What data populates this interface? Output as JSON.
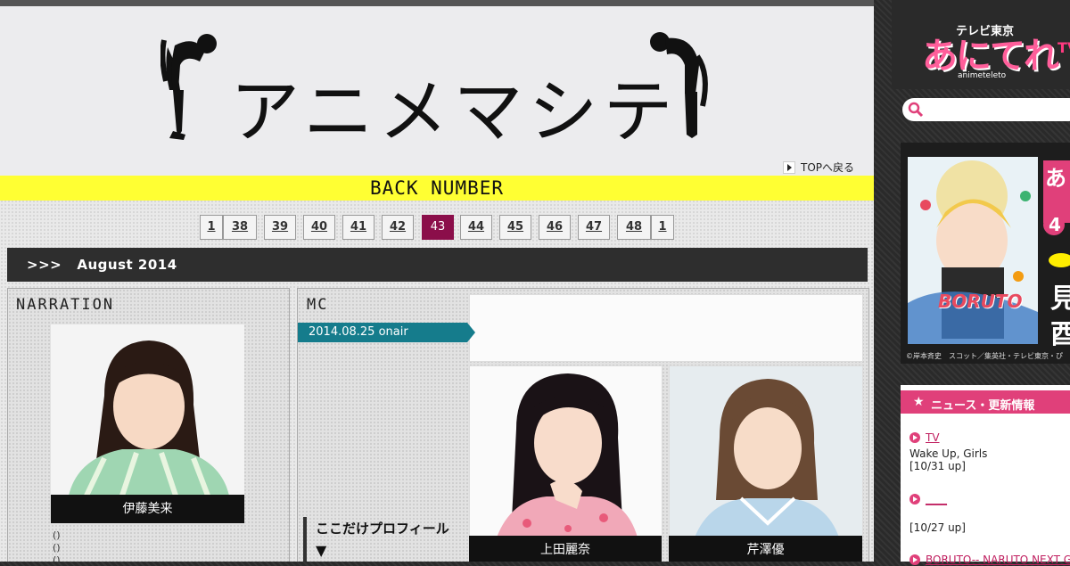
{
  "hero": {
    "title": "アニメマシテ",
    "top_link": "TOPへ戻る",
    "back_number": "BACK NUMBER"
  },
  "pager": {
    "items": [
      "1",
      "38",
      "39",
      "40",
      "41",
      "42",
      "43",
      "44",
      "45",
      "46",
      "47",
      "48",
      "1"
    ],
    "active": "43"
  },
  "month": ">>>   August 2014",
  "narration": {
    "heading": "NARRATION",
    "name": "伊藤美来",
    "notes": [
      "()",
      "()",
      "()"
    ]
  },
  "mc": {
    "heading": "MC",
    "onair": "2014.08.25 onair",
    "profile_label": "ここだけプロフィール",
    "profile_arrow": "▼",
    "people": [
      {
        "name": "上田麗奈"
      },
      {
        "name": "芹澤優"
      }
    ]
  },
  "sidebar": {
    "logo_small": "テレビ東京",
    "logo_main": "あにてれ",
    "logo_sub": "animeteleto",
    "logo_cut": "TV",
    "search_placeholder": "",
    "banner_credit": "©岸本斉史　スコット／集英社・テレビ東京・ぴ",
    "banner_title": "BORUTO",
    "banner_side_chars": [
      "あ",
      "4",
      "見",
      "酉"
    ],
    "news_title": "ニュース・更新情報",
    "news": [
      {
        "link": "TV",
        "title": "Wake Up, Girls",
        "date": "[10/31 up]"
      },
      {
        "link": "____",
        "title": "",
        "date": "[10/27 up]"
      },
      {
        "link": "BORUTO-- NARUTO NEXT G",
        "title": "",
        "date": ""
      }
    ]
  },
  "colors": {
    "accent": "#8b0e4a",
    "yellow": "#ffff33",
    "teal": "#157c8c",
    "pink": "#e0407a"
  }
}
